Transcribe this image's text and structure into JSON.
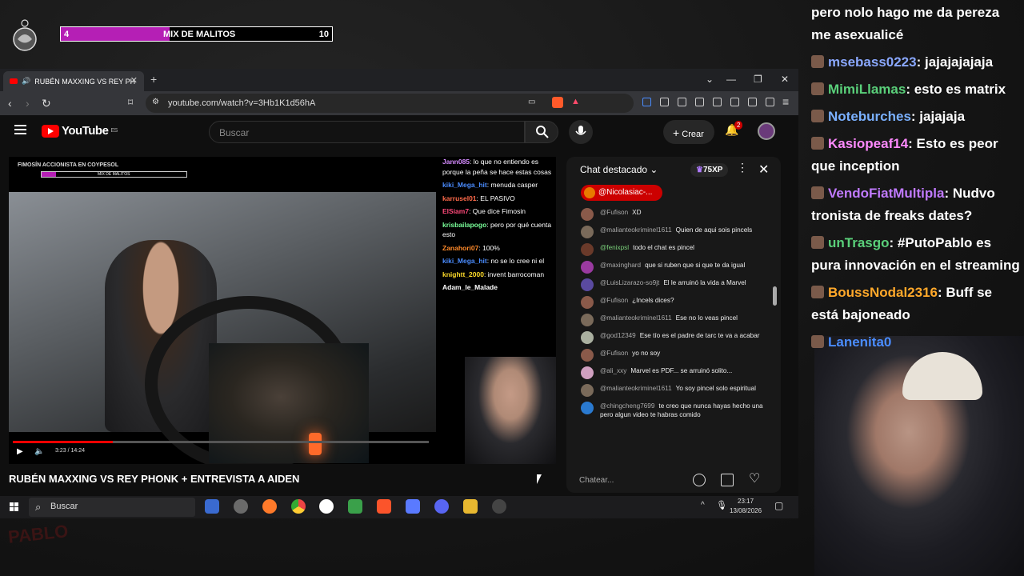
{
  "overlay": {
    "left_num": "4",
    "title": "MIX DE MALITOS",
    "right_num": "10",
    "progress": 0.4
  },
  "browser": {
    "tab_title": "RUBÉN MAXXING VS REY PH",
    "url": "youtube.com/watch?v=3Hb1K1d56hA"
  },
  "youtube": {
    "logo": "YouTube",
    "region": "ES",
    "search_placeholder": "Buscar",
    "create_label": "Crear",
    "notif_count": "2"
  },
  "video": {
    "overlay_title": "FIMOSÍN ACCIONISTA EN COYPESOL",
    "overlay_bar": "MIX DE MALITOS",
    "time": "3:23 / 14:24",
    "progress": 0.24,
    "title": "RUBÉN MAXXING VS REY PHONK + ENTREVISTA A AIDEN",
    "chat": [
      {
        "user": "Jann085",
        "text": ": lo que no entiendo es porque la peña se hace estas cosas",
        "color": "#d48bff"
      },
      {
        "user": "kiki_Mega_hit",
        "text": ": menuda casper",
        "color": "#4a8cff"
      },
      {
        "user": "karrusel01",
        "text": ": EL PASIVO",
        "color": "#ff6a4a"
      },
      {
        "user": "ElSiam7",
        "text": ": Que dice Fimosin",
        "color": "#ff4a7a"
      },
      {
        "user": "krisbailapogo",
        "text": ": pero por qué cuenta esto",
        "color": "#7aff9a"
      },
      {
        "user": "Zanahori07",
        "text": ": 100%",
        "color": "#ff8a2a"
      },
      {
        "user": "kiki_Mega_hit",
        "text": ": no se lo cree ni el",
        "color": "#4a8cff"
      },
      {
        "user": "knightt_2000",
        "text": ": invent barrocoman",
        "color": "#ffdc2a"
      },
      {
        "user": "Adam_le_Malade",
        "text": "",
        "color": "#ffffff"
      }
    ]
  },
  "chat": {
    "header": "Chat destacado",
    "xp": "75XP",
    "pinned": "@Nicolasiac-...",
    "input_placeholder": "Chatear...",
    "messages": [
      {
        "author": "@Fufison",
        "text": "XD",
        "avatar": "#8a5a4a"
      },
      {
        "author": "@malianteokriminel1611",
        "text": "Quien de aqui sois pincels",
        "avatar": "#7a6a5a"
      },
      {
        "author": "@fenixpsl",
        "text": "todo el chat es pincel",
        "avatar": "#6a3a2a",
        "author_color": "#7ad07a"
      },
      {
        "author": "@maxinghard",
        "text": "que si ruben que si que te da igual",
        "avatar": "#9a3aa0"
      },
      {
        "author": "@LuisLizarazo-so9jt",
        "text": "El le arruinó la vida a Marvel",
        "avatar": "#5a4aa0"
      },
      {
        "author": "@Fufison",
        "text": "¿Incels dices?",
        "avatar": "#8a5a4a"
      },
      {
        "author": "@malianteokriminel1611",
        "text": "Ese no lo veas pincel",
        "avatar": "#7a6a5a"
      },
      {
        "author": "@god12349",
        "text": "Ese tío es el padre de tarc te va a acabar",
        "avatar": "#aab0a0"
      },
      {
        "author": "@Fufison",
        "text": "yo no soy",
        "avatar": "#8a5a4a"
      },
      {
        "author": "@ali_xxy",
        "text": "Marvel es PDF... se arruinó solito...",
        "avatar": "#d0a0c0"
      },
      {
        "author": "@malianteokriminel1611",
        "text": "Yo soy pincel solo espiritual",
        "avatar": "#7a6a5a"
      },
      {
        "author": "@chingcheng7699",
        "text": "te creo que nunca hayas hecho una pero algun video te habras comido",
        "avatar": "#2a7ad0"
      }
    ]
  },
  "taskbar": {
    "search": "Buscar",
    "time": "23:17",
    "date": "13/08/2026"
  },
  "stream_chat": [
    {
      "user": "",
      "text": "pero nolo hago me da pereza me asexualicé",
      "color": "#ffffff"
    },
    {
      "user": "msebass0223",
      "text": ": jajajajajaja",
      "color": "#8aa8ff"
    },
    {
      "user": "MimiLlamas",
      "text": ": esto es matrix",
      "color": "#5ad07a"
    },
    {
      "user": "Noteburches",
      "text": ": jajajaja",
      "color": "#7ab0ff"
    },
    {
      "user": "Kasiopeaf14",
      "text": ": Esto es peor que inception",
      "color": "#ff8aff"
    },
    {
      "user": "VendoFiatMultipla",
      "text": ": Nudvo tronista de freaks dates?",
      "color": "#c07aff"
    },
    {
      "user": "unTrasgo",
      "text": ": #PutoPablo es pura innovación en el streaming",
      "color": "#5ad07a"
    },
    {
      "user": "BoussNodal2316",
      "text": ": Buff se está bajoneado",
      "color": "#ffa82a"
    },
    {
      "user": "Lanenita0",
      "text": "",
      "color": "#4a8cff"
    }
  ]
}
